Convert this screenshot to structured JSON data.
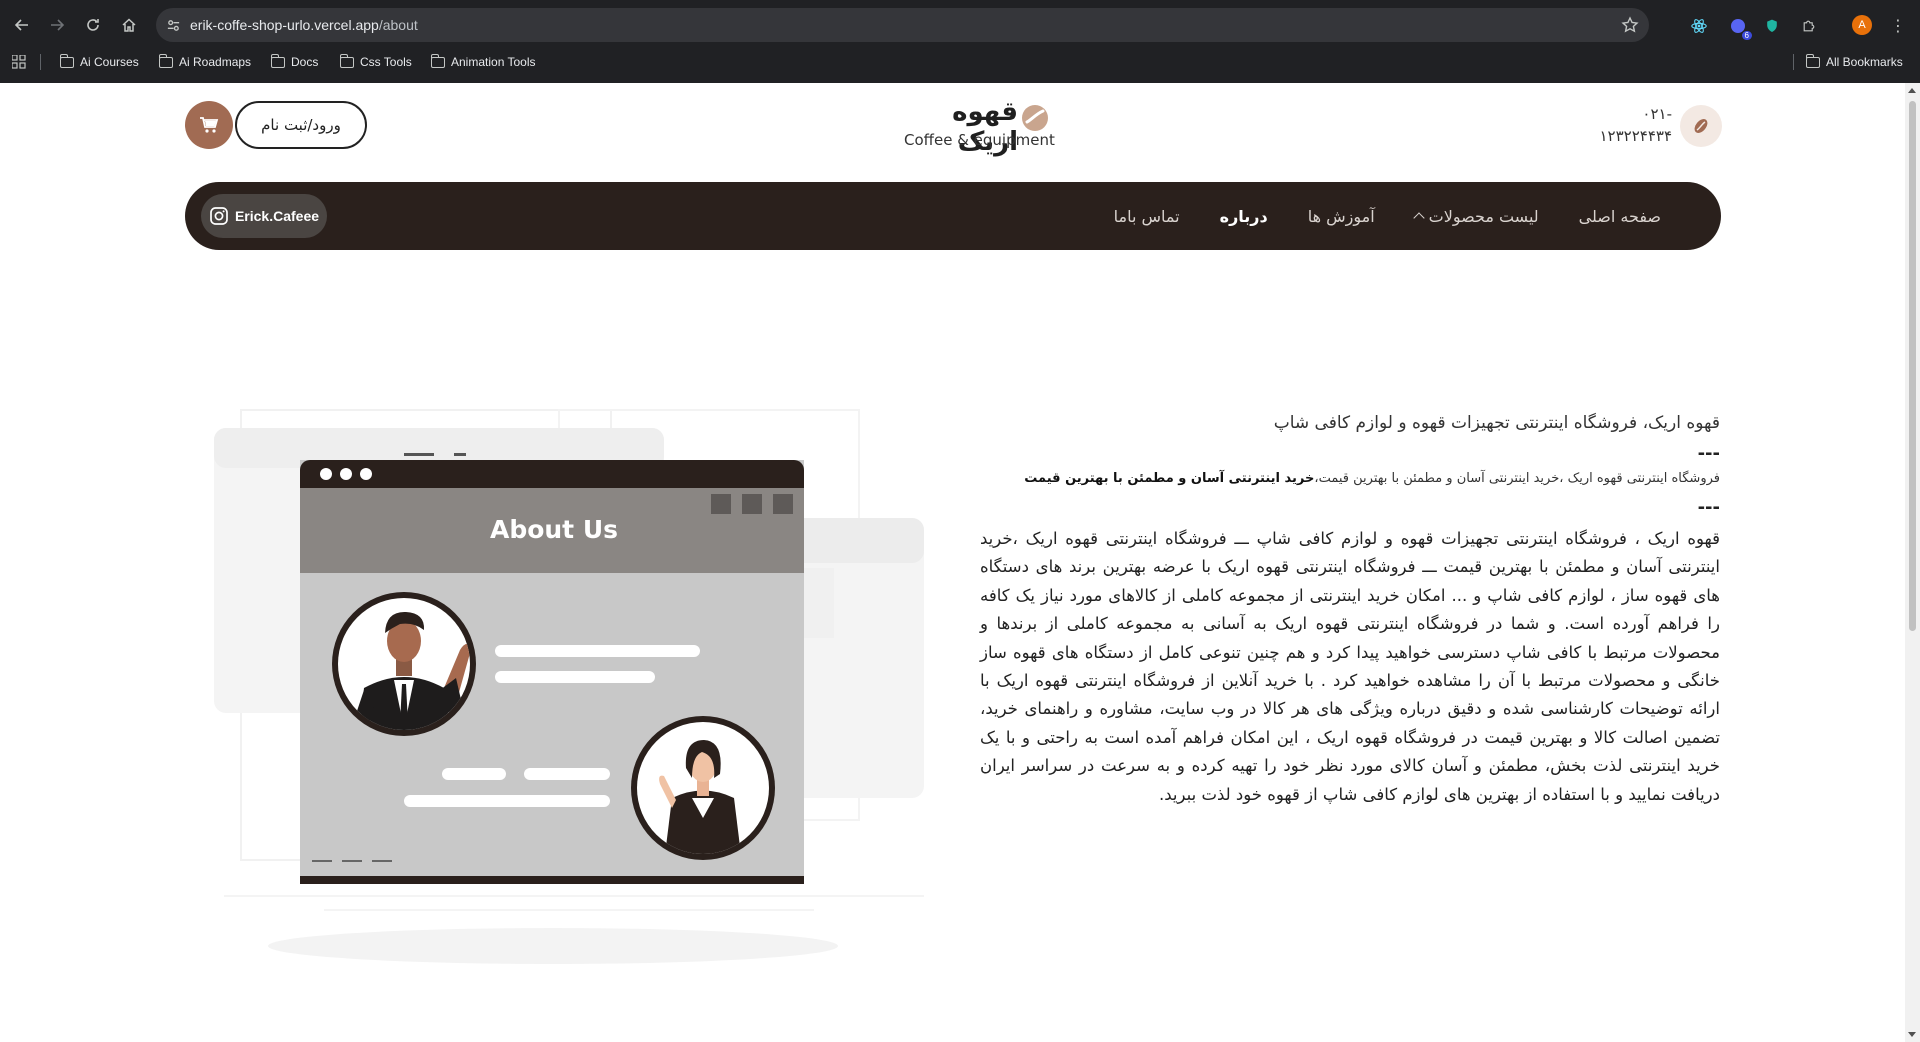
{
  "browser": {
    "url_host": "erik-coffe-shop-urlo.vercel.app",
    "url_path": "/about",
    "extension_badge": "6",
    "profile_initial": "A",
    "bookmarks": [
      "Ai Courses",
      "Ai Roadmaps",
      "Docs",
      "Css Tools",
      "Animation Tools"
    ],
    "all_bookmarks": "All Bookmarks"
  },
  "header": {
    "login_label": "ورود/ثبت نام",
    "logo_fa": "قهوه اریک",
    "logo_en": "Coffee & equipment",
    "phone_line1": "۰۲۱-",
    "phone_line2": "۱۲۳۲۲۴۴۳۴"
  },
  "nav": {
    "instagram": "Erick.Cafeee",
    "items": [
      {
        "label": "صفحه اصلی"
      },
      {
        "label": "لیست محصولات"
      },
      {
        "label": "آموزش ها"
      },
      {
        "label": "درباره"
      },
      {
        "label": "تماس باما"
      }
    ]
  },
  "illustration": {
    "title": "About Us"
  },
  "about": {
    "title": "قهوه اریک، فروشگاه اینترنتی تجهیزات قهوه و لوازم کافی شاپ",
    "separator": "---",
    "subtitle_plain": "فروشگاه اینترنتی قهوه اریک ،خرید اینترنتی آسان و مطمئن با بهترین قیمت،",
    "subtitle_bold": "خرید اینترنتی آسان و مطمئن با بهترین قیمت",
    "body": "قهوه اریک ، فروشگاه اینترنتی تجهیزات قهوه و لوازم کافی شاپ ـــ فروشگاه اینترنتی قهوه اریک ،خرید اینترنتی آسان و مطمئن با بهترین قیمت ـــ فروشگاه اینترنتی قهوه اریک با عرضه بهترین برند های دستگاه های قهوه ساز ، لوازم کافی شاپ و ... امکان خرید اینترنتی از مجموعه کاملی از کالاهای مورد نیاز یک کافه را فراهم آورده است. و شما در فروشگاه اینترنتی قهوه اریک به آسانی به مجموعه کاملی از برندها و محصولات مرتبط با کافی شاپ دسترسی خواهید پیدا کرد و هم چنین تنوعی کامل از دستگاه های قهوه ساز خانگی و محصولات مرتبط با آن را مشاهده خواهید کرد . با خرید آنلاین از فروشگاه اینترنتی قهوه اریک با ارائه توضیحات کارشناسی شده و دقیق درباره ویژگی های هر کالا در وب سایت، مشاوره و راهنمای خرید، تضمین اصالت کالا و بهترین قیمت در فروشگاه قهوه اریک ، این امکان فراهم آمده است به راحتی و با یک خرید اینترنتی لذت بخش، مطمئن و آسان کالای مورد نظر خود را تهیه کرده و به سرعت در سراسر ایران دریافت نمایید و با استفاده از بهترین های لوازم کافی شاپ از قهوه خود لذت ببرید."
  },
  "colors": {
    "navbar_bg": "#2a201c",
    "cart_bg": "#a16b53",
    "logo_accent": "#c9a58e"
  }
}
